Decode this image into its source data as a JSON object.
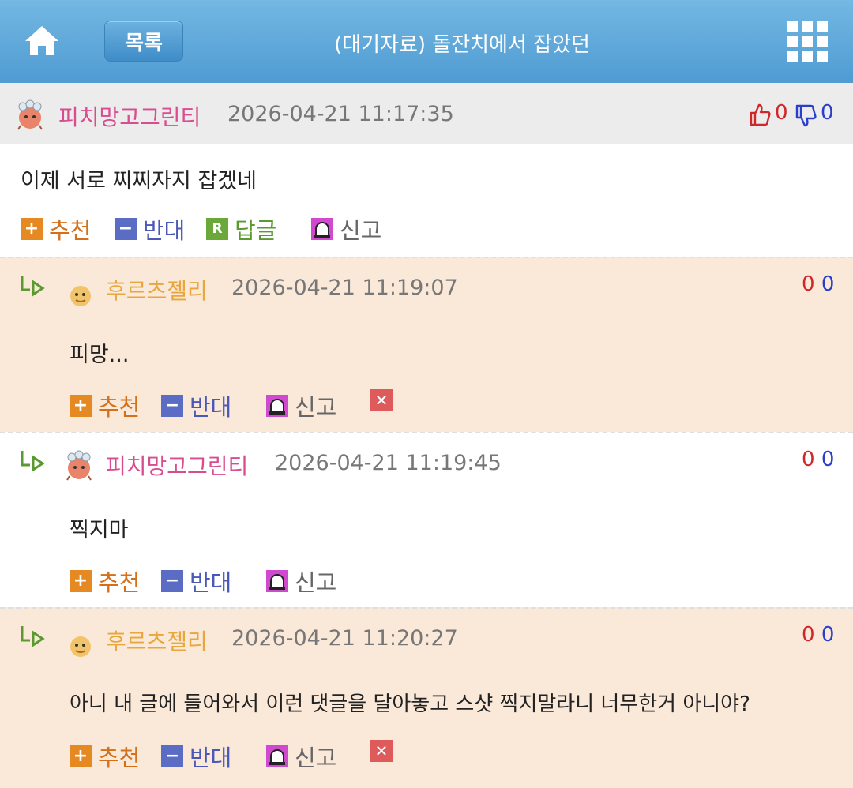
{
  "header": {
    "list_label": "목록",
    "title": "(대기자료) 돌잔치에서 잡았던"
  },
  "post": {
    "author": "피치망고그린티",
    "date": "2026-04-21 11:17:35",
    "like_count": "0",
    "dislike_count": "0",
    "body": "이제 서로 찌찌자지 잡겠네",
    "actions": {
      "recommend": "추천",
      "oppose": "반대",
      "reply": "답글",
      "report": "신고"
    }
  },
  "comments": [
    {
      "author": "후르츠젤리",
      "date": "2026-04-21 11:19:07",
      "up": "0",
      "down": "0",
      "body": "피망...",
      "recommend": "추천",
      "oppose": "반대",
      "report": "신고"
    },
    {
      "author": "피치망고그린티",
      "date": "2026-04-21 11:19:45",
      "up": "0",
      "down": "0",
      "body": "찍지마",
      "recommend": "추천",
      "oppose": "반대",
      "report": "신고"
    },
    {
      "author": "후르츠젤리",
      "date": "2026-04-21 11:20:27",
      "up": "0",
      "down": "0",
      "body": "아니 내 글에 들어와서 이런 댓글을 달아놓고 스샷 찍지말라니 너무한거 아니야?",
      "recommend": "추천",
      "oppose": "반대",
      "report": "신고"
    }
  ],
  "colors": {
    "header_blue": "#4f9bd2",
    "peach_author": "#d94c8f",
    "jelly_author": "#e8a63c",
    "comment_bg": "#fae9d9",
    "count_red": "#d0282a",
    "count_blue": "#2a3ec9"
  },
  "icons": [
    "home-icon",
    "grid-menu-icon",
    "thumbs-up-icon",
    "thumbs-down-icon",
    "plus-icon",
    "minus-icon",
    "reply-icon",
    "report-icon",
    "delete-icon",
    "reply-arrow-icon"
  ]
}
